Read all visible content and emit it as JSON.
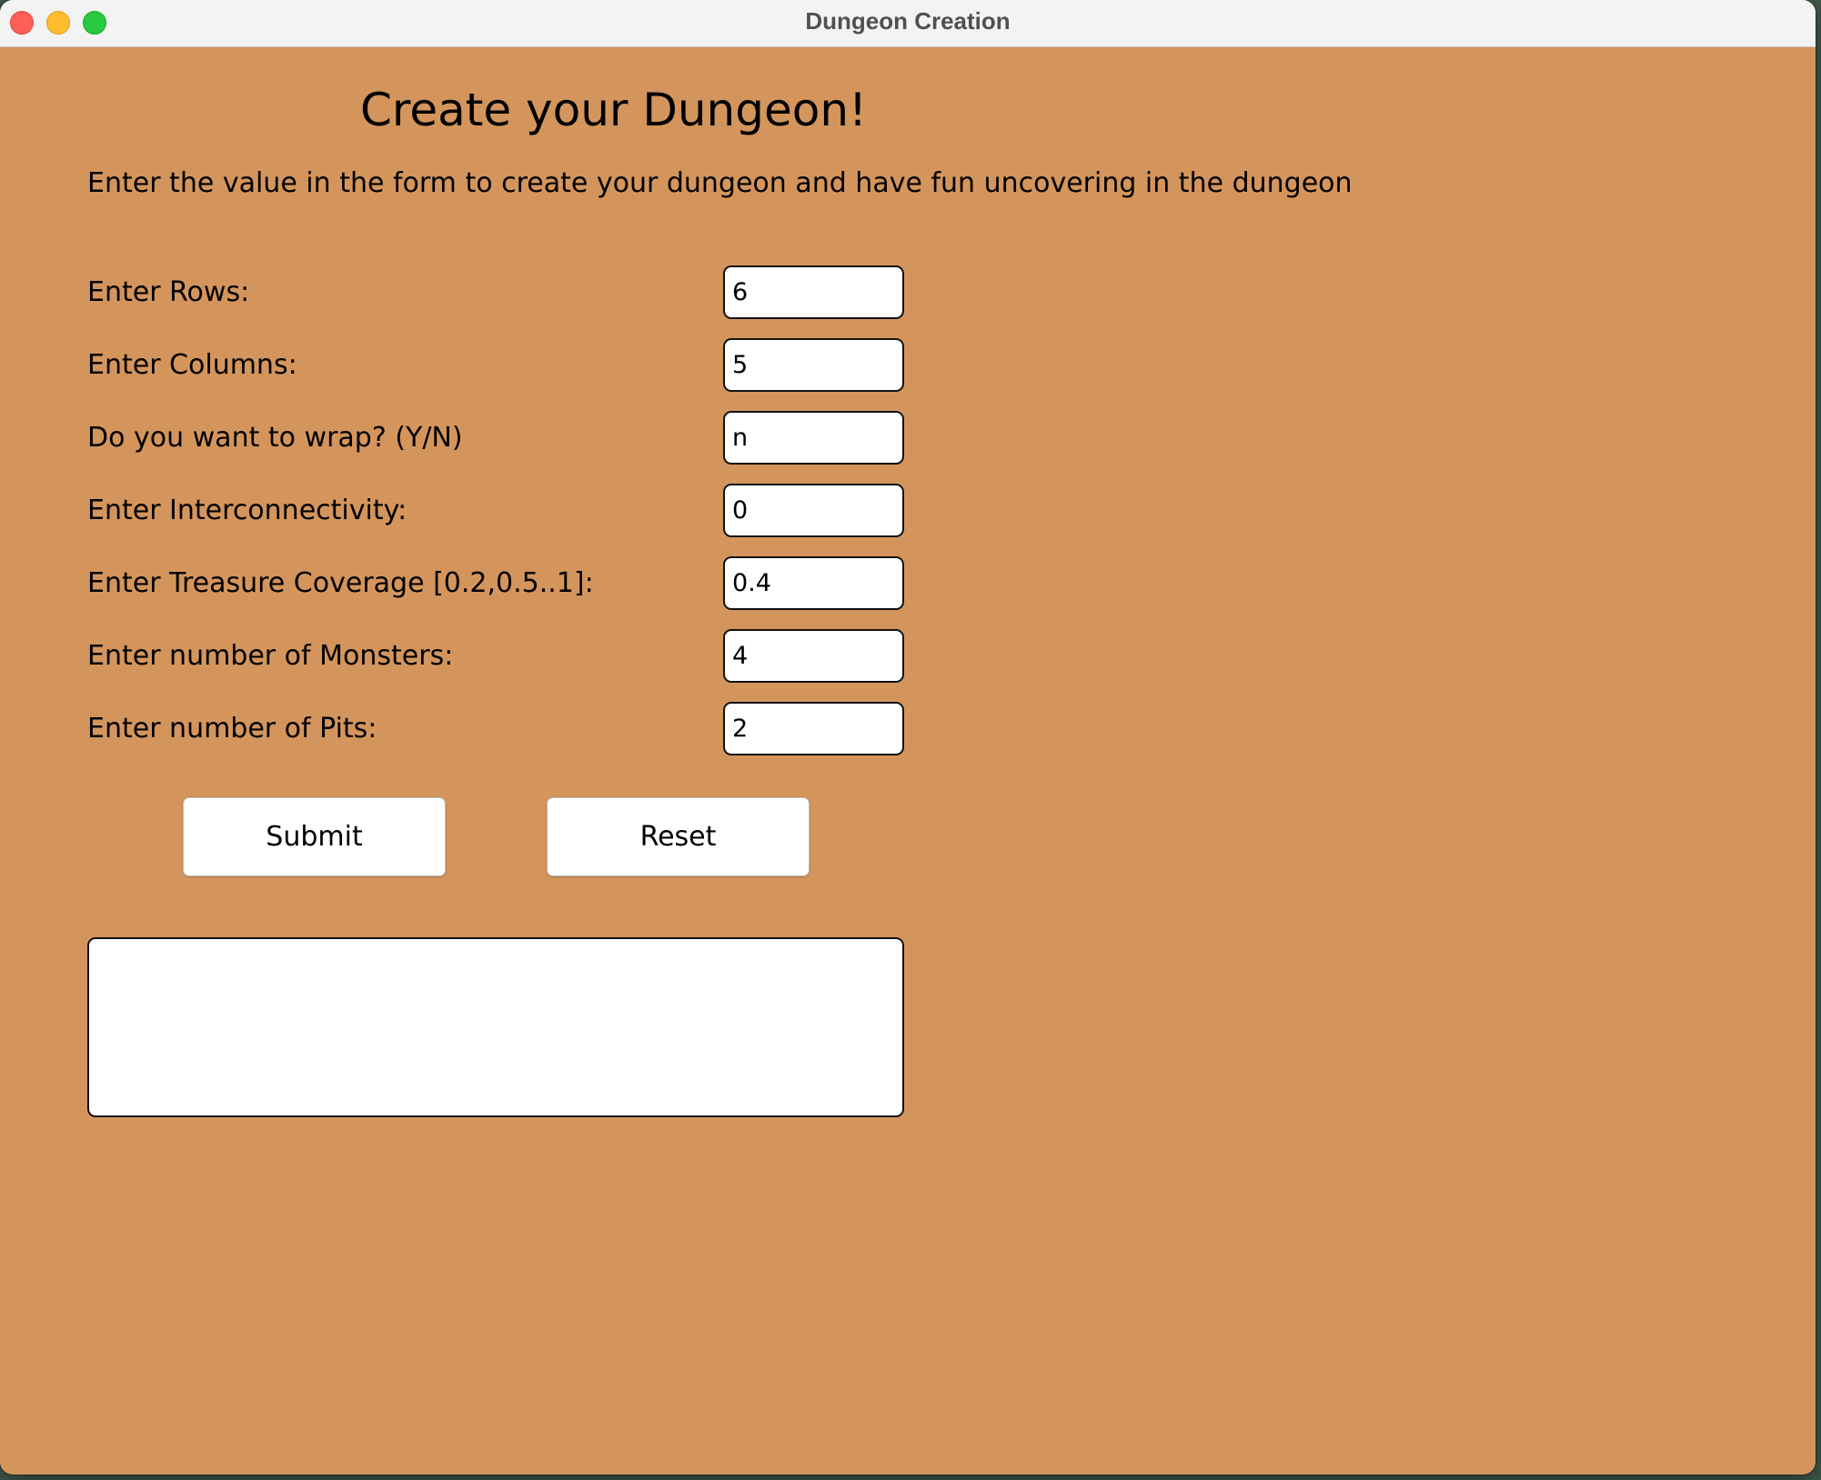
{
  "window": {
    "title": "Dungeon Creation"
  },
  "header": {
    "title": "Create your Dungeon!",
    "subtitle": "Enter the value in the form to create your dungeon and have fun uncovering in the dungeon"
  },
  "form": {
    "rows": {
      "label": "Enter Rows:",
      "value": "6"
    },
    "columns": {
      "label": "Enter Columns:",
      "value": "5"
    },
    "wrap": {
      "label": "Do you want to wrap? (Y/N)",
      "value": "n"
    },
    "interconnectivity": {
      "label": "Enter Interconnectivity:",
      "value": "0"
    },
    "treasure": {
      "label": "Enter Treasure Coverage [0.2,0.5..1]:",
      "value": "0.4"
    },
    "monsters": {
      "label": "Enter number of Monsters:",
      "value": "4"
    },
    "pits": {
      "label": "Enter number of Pits:",
      "value": "2"
    }
  },
  "buttons": {
    "submit": "Submit",
    "reset": "Reset"
  },
  "output": {
    "value": ""
  },
  "colors": {
    "background": "#d4955c",
    "field": "#ffffff",
    "text": "#000000"
  }
}
